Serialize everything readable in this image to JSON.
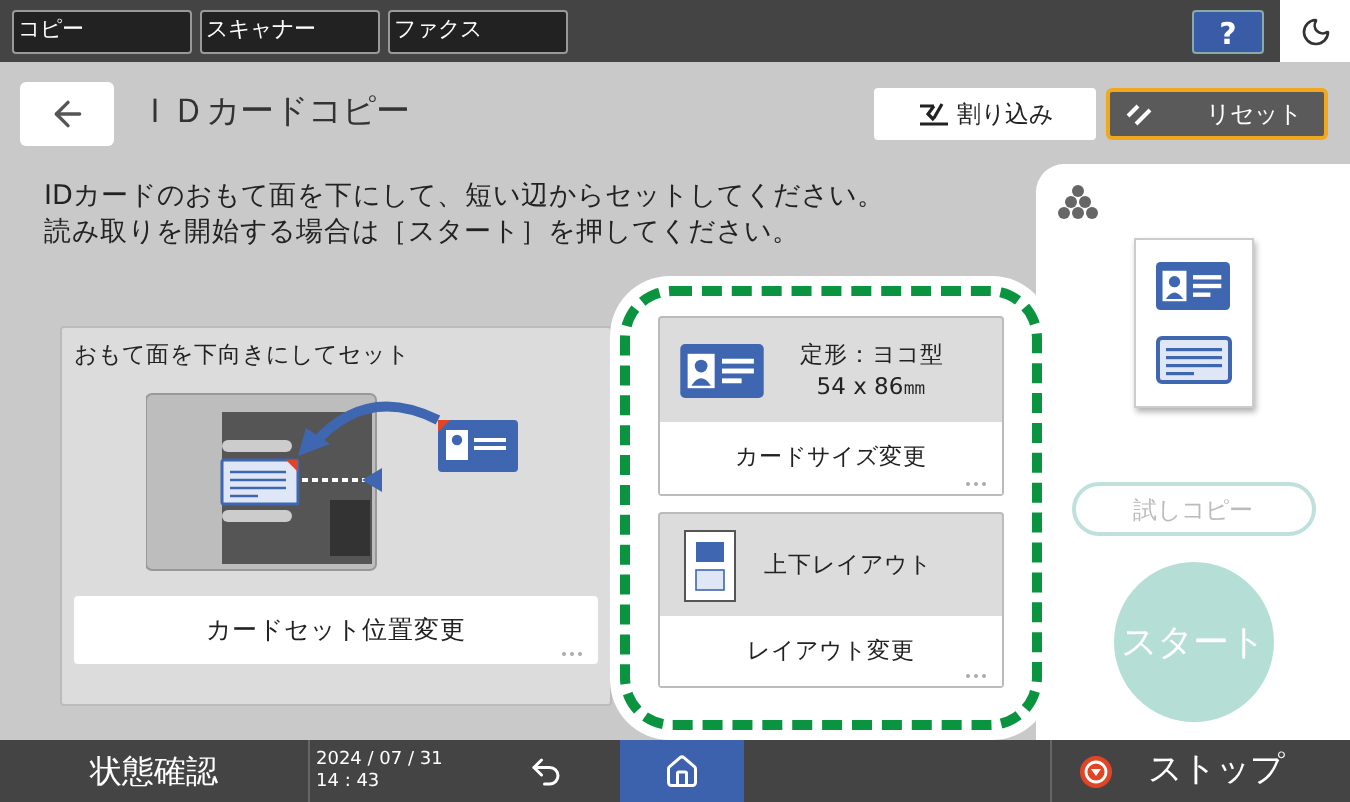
{
  "top_tabs": [
    {
      "label": "コピー"
    },
    {
      "label": "スキャナー"
    },
    {
      "label": "ファクス"
    }
  ],
  "help_button": "?",
  "header": {
    "title": "ＩＤカードコピー",
    "interrupt_button": "割り込み",
    "reset_button": "リセット"
  },
  "instruction": [
    "IDカードのおもて面を下にして、短い辺からセットしてください。",
    "読み取りを開始する場合は［スタート］を押してください。"
  ],
  "placement_panel": {
    "title": "おもて面を下向きにしてセット",
    "button": "カードセット位置変更"
  },
  "card_size": {
    "line1": "定形：ヨコ型",
    "line2": "54 x 86㎜",
    "button": "カードサイズ変更"
  },
  "layout": {
    "label": "上下レイアウト",
    "button": "レイアウト変更"
  },
  "side_panel": {
    "sample_copy": {
      "label": "試しコピー",
      "disabled": true
    },
    "start": {
      "label": "スタート",
      "disabled": true
    }
  },
  "bottom_bar": {
    "status": "状態確認",
    "date": "2024 / 07 / 31",
    "time": "14 : 43",
    "stop": "ストップ"
  }
}
